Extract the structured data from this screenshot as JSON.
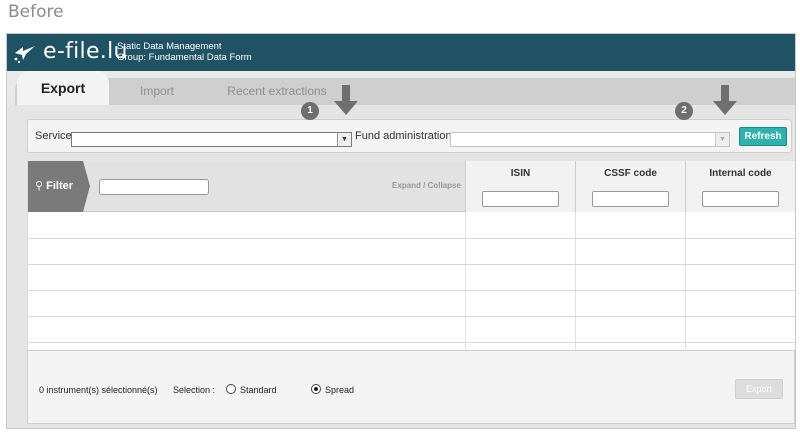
{
  "caption": "Before",
  "header": {
    "logo": "e-file.lu",
    "subtitle_line1": "Static Data Management",
    "subtitle_line2": "Group: Fundamental Data Form",
    "bg_color": "#1f5363"
  },
  "tabs": [
    {
      "label": "Export",
      "active": true
    },
    {
      "label": "Import",
      "active": false
    },
    {
      "label": "Recent extractions",
      "active": false
    }
  ],
  "service_bar": {
    "service_label": "Service",
    "service_value": "",
    "fund_admin_label": "Fund administration",
    "fund_admin_value": "",
    "refresh_label": "Refresh",
    "step1": "1",
    "step2": "2"
  },
  "grid": {
    "filter_label": "Filter",
    "filter_value": "",
    "expand_collapse": "Expand / Collapse",
    "columns": [
      "ISIN",
      "CSSF code",
      "Internal code"
    ]
  },
  "footer": {
    "selected_text": "0 instrument(s) sélectionné(s)",
    "selection_label": "Selection :",
    "option_standard": "Standard",
    "option_spread": "Spread",
    "selected_option": "Spread",
    "export_label": "Export"
  },
  "colors": {
    "accent": "#2fb1b0",
    "filter_tab": "#7a7a7a"
  }
}
